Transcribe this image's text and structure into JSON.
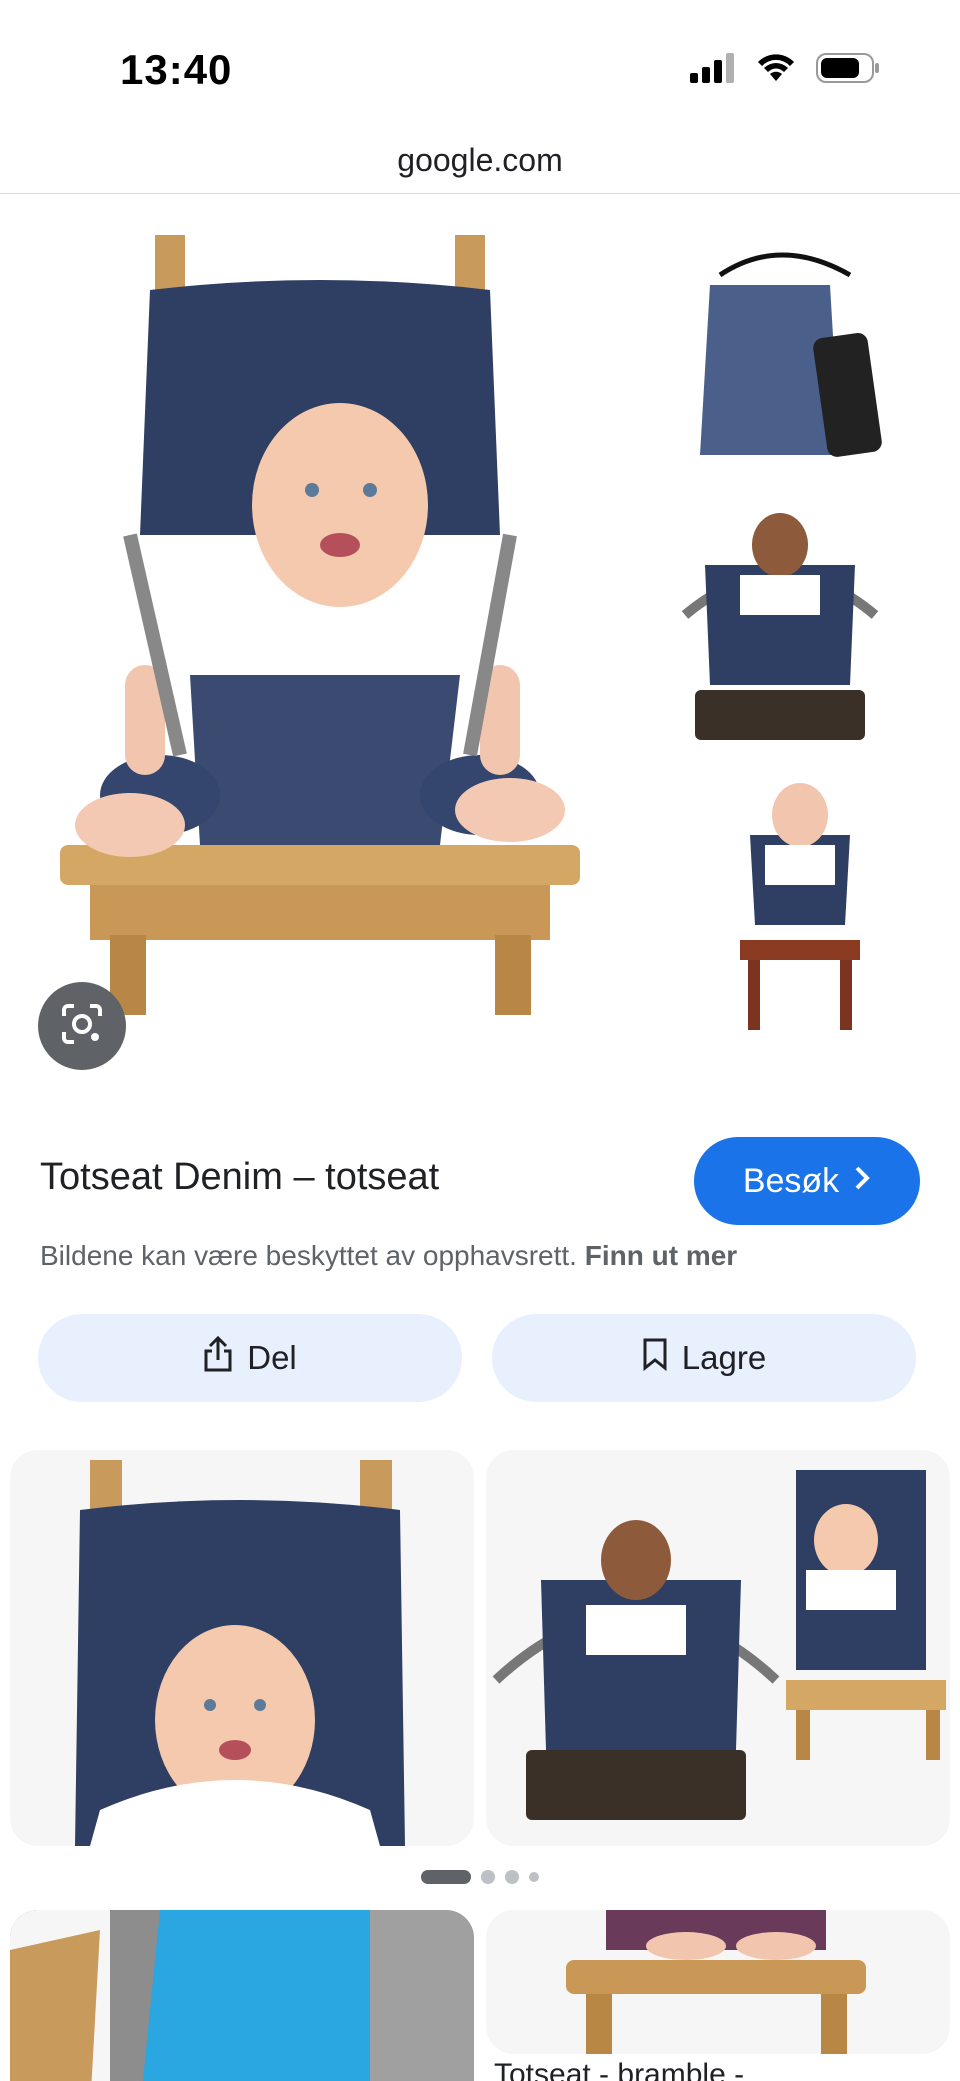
{
  "status": {
    "time": "13:40"
  },
  "browser": {
    "url": "google.com"
  },
  "result": {
    "title": "Totseat Denim – totseat",
    "visit_label": "Besøk",
    "copyright_text": "Bildene kan være beskyttet av opphavsrett.",
    "learn_more": "Finn ut mer",
    "share_label": "Del",
    "save_label": "Lagre"
  },
  "related": {
    "card4_label": "Totseat - bramble -"
  },
  "pager": {
    "active_index": 0,
    "count": 4
  },
  "colors": {
    "accent": "#1a73e8",
    "action_bg": "#e8f0fe",
    "denim": "#2f3e63"
  },
  "icons": [
    "signal-icon",
    "wifi-icon",
    "battery-icon",
    "lens-icon",
    "chevron-right-icon",
    "share-icon",
    "bookmark-icon"
  ]
}
